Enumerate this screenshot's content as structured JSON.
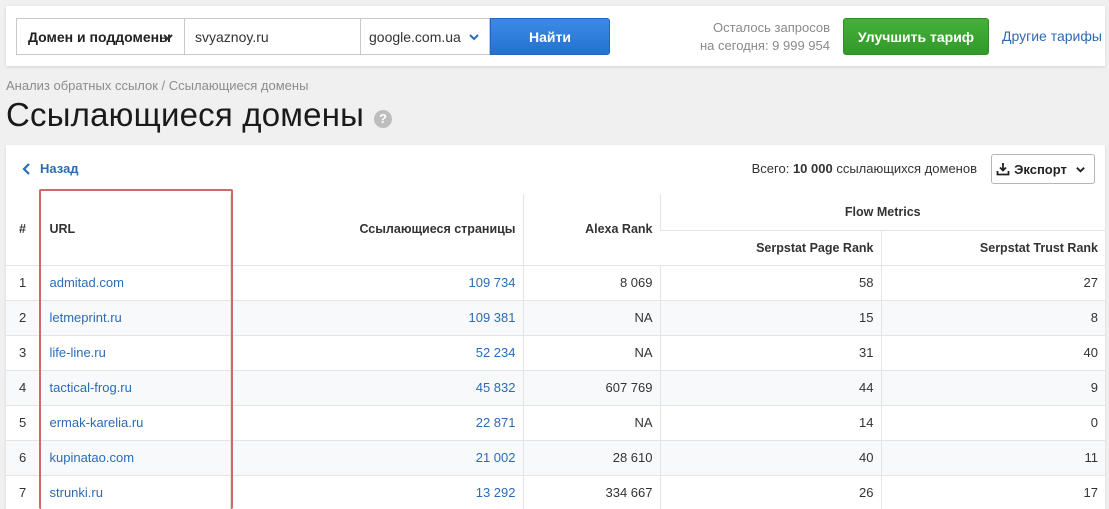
{
  "topbar": {
    "scope_select": "Домен и поддомены",
    "domain_value": "svyaznoy.ru",
    "search_engine": "google.com.ua",
    "find_label": "Найти",
    "quota_line1": "Осталось запросов",
    "quota_line2": "на сегодня: 9 999 954",
    "upgrade_label": "Улучшить тариф",
    "other_plans_label": "Другие тарифы"
  },
  "breadcrumb": "Анализ обратных ссылок / Ссылающиеся домены",
  "page_title": "Ссылающиеся домены",
  "help_icon": "?",
  "panel": {
    "back_label": "Назад",
    "total_prefix": "Всего: ",
    "total_count": "10 000",
    "total_suffix": " ссылающихся доменов",
    "export_label": "Экспорт"
  },
  "table": {
    "headers": {
      "num": "#",
      "url": "URL",
      "pages": "Ссылающиеся страницы",
      "alexa": "Alexa Rank",
      "flow": "Flow Metrics",
      "page_rank": "Serpstat Page Rank",
      "trust_rank": "Serpstat Trust Rank"
    },
    "rows": [
      {
        "num": "1",
        "url": "admitad.com",
        "pages": "109 734",
        "alexa": "8 069",
        "page_rank": "58",
        "trust_rank": "27"
      },
      {
        "num": "2",
        "url": "letmeprint.ru",
        "pages": "109 381",
        "alexa": "NA",
        "page_rank": "15",
        "trust_rank": "8"
      },
      {
        "num": "3",
        "url": "life-line.ru",
        "pages": "52 234",
        "alexa": "NA",
        "page_rank": "31",
        "trust_rank": "40"
      },
      {
        "num": "4",
        "url": "tactical-frog.ru",
        "pages": "45 832",
        "alexa": "607 769",
        "page_rank": "44",
        "trust_rank": "9"
      },
      {
        "num": "5",
        "url": "ermak-karelia.ru",
        "pages": "22 871",
        "alexa": "NA",
        "page_rank": "14",
        "trust_rank": "0"
      },
      {
        "num": "6",
        "url": "kupinatao.com",
        "pages": "21 002",
        "alexa": "28 610",
        "page_rank": "40",
        "trust_rank": "11"
      },
      {
        "num": "7",
        "url": "strunki.ru",
        "pages": "13 292",
        "alexa": "334 667",
        "page_rank": "26",
        "trust_rank": "17"
      }
    ]
  },
  "colors": {
    "link": "#2b6cb6",
    "find_button": "#2b7ad6",
    "upgrade_button": "#3aa631",
    "highlight_border": "#d06a6a"
  }
}
